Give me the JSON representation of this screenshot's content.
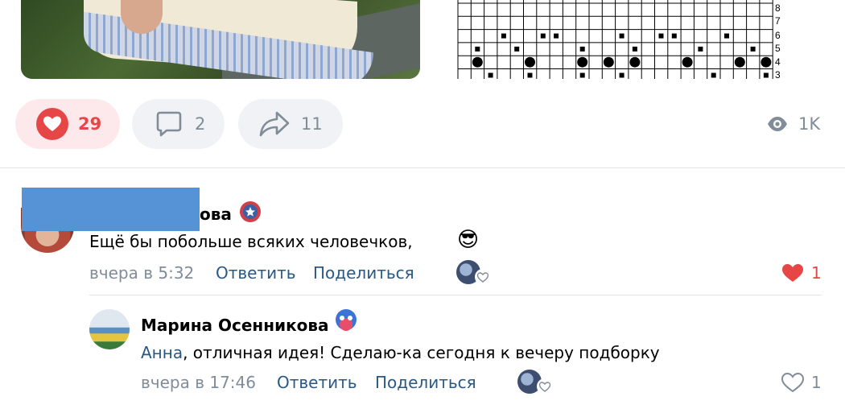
{
  "post": {
    "actions": {
      "likes": "29",
      "comments": "2",
      "shares": "11",
      "views": "1K"
    }
  },
  "comments": [
    {
      "author_visible_fragment": "ова",
      "text": "Ещё бы побольше всяких человечков,",
      "emoji": "😎",
      "time": "вчера в 5:32",
      "reply_label": "Ответить",
      "share_label": "Поделиться",
      "likes": "1",
      "liked": true
    },
    {
      "author": "Марина Осенникова",
      "mention": "Анна",
      "text": ", отличная идея! Сделаю-ка сегодня к вечеру подборку",
      "time": "вчера в 17:46",
      "reply_label": "Ответить",
      "share_label": "Поделиться",
      "likes": "1",
      "liked": false
    }
  ],
  "colors": {
    "accent_red": "#e64646",
    "link_blue": "#2a5885",
    "muted": "#818c99",
    "redaction": "#5592d6"
  }
}
